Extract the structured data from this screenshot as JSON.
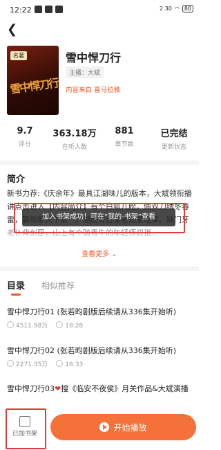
{
  "status": {
    "time": "12:22",
    "speed": "2.30\nKB/s",
    "battery": "80"
  },
  "book": {
    "title": "雪中悍刀行",
    "badge": "名著",
    "anchor": "主播：大斌",
    "source": "内容来自 喜马拉雅"
  },
  "stats": [
    {
      "value": "9.7",
      "label": "评分"
    },
    {
      "value": "363.18万",
      "label": "在听人数"
    },
    {
      "value": "881",
      "label": "章节数"
    },
    {
      "value": "已完结",
      "label": "更新状态"
    }
  ],
  "intro": {
    "heading": "简介",
    "text": "新书力荐:《庆余年》最具江湖味儿的版本，大斌领衔播讲点击进入【内容简介】有个白狐儿脸，佩双刀绣冬春雷，要做那天下第一。湖底有白发老魁爱吃荤。缺门牙老仆背剑匣，山上有个骑青牛的年轻师叔祖...",
    "more": "查看更多"
  },
  "toast": "加入书架成功！可在“我的-书架”查看",
  "tabs": {
    "catalog": "目录",
    "recommend": "相似推荐"
  },
  "episodes": [
    {
      "title": "雪中悍刀行01 (张若昀剧版后续请从336集开始听)",
      "plays": "4511.98万",
      "duration": "18:28"
    },
    {
      "title": "雪中悍刀行02 (张若昀剧版后续请从336集开始听)",
      "plays": "2271.35万",
      "duration": "18:33"
    },
    {
      "title_a": "雪中悍刀行03",
      "title_b": "搜《临安不夜侯》月关作品&大斌演播"
    }
  ],
  "bottom": {
    "shelf_label": "已加书架",
    "play_label": "开始播放"
  }
}
